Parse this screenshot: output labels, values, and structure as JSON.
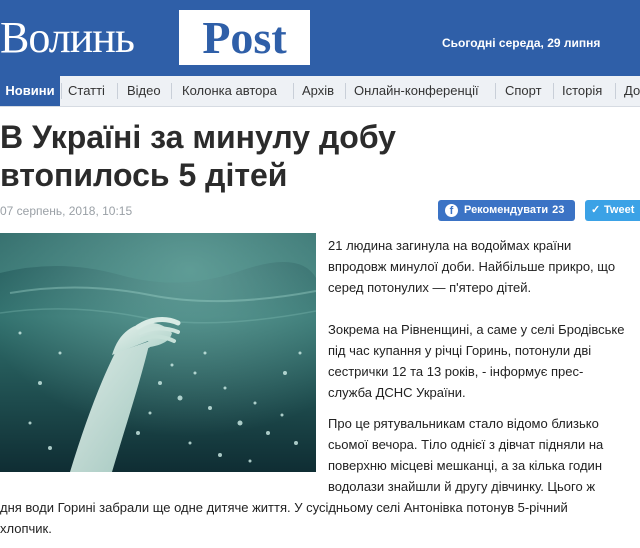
{
  "header": {
    "logo_volyn": "Волинь",
    "logo_post": "Post",
    "date": "Сьогодні середа, 29 липня"
  },
  "nav": {
    "items": [
      {
        "label": "Новини",
        "active": true
      },
      {
        "label": "Статті"
      },
      {
        "label": "Відео"
      },
      {
        "label": "Колонка автора"
      },
      {
        "label": "Архів"
      },
      {
        "label": "Онлайн-конференції"
      },
      {
        "label": "Спорт"
      },
      {
        "label": "Історія"
      },
      {
        "label": "До"
      }
    ]
  },
  "article": {
    "title_lines": [
      "В Україні за минулу добу",
      "втопилось 5 дітей"
    ],
    "date": "07 серпень, 2018, 10:15",
    "share": {
      "facebook_label": "Рекомендувати",
      "facebook_count": "23",
      "twitter_label": "Tweet"
    },
    "photo_icon": "drowning-hand-underwater-photo",
    "paragraph1_lines": [
      "21 людина загинула на водоймах країни",
      "впродовж минулої доби. Найбільше прикро, що",
      "серед потонулих — п'ятеро дітей."
    ],
    "paragraph2_lines": [
      "Зокрема на Рівненщині, а саме у селі Бродівське",
      "під час купання у річці Горинь, потонули дві",
      "сестрички 12 та 13 років, - інформує прес-",
      "служба ДСНС України."
    ],
    "paragraph3_lines": [
      "Про це рятувальникам стало відомо близько",
      "сьомої вечора. Тіло однієї з дівчат підняли на",
      "поверхню місцеві мешканці, а за кілька годин",
      "водолази знайшли й другу дівчинку. Цього ж",
      "дня води Горині забрали ще одне дитяче життя. У сусідньому селі Антонівка потонув 5-річний",
      "хлопчик."
    ]
  },
  "colors": {
    "brand_blue": "#2f5fa8",
    "facebook_blue": "#3b73c5",
    "twitter_blue": "#3ba2e6"
  }
}
